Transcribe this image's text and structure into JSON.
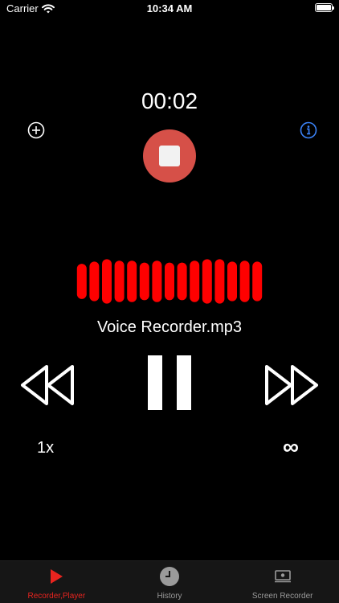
{
  "status_bar": {
    "carrier": "Carrier",
    "time": "10:34 AM",
    "wifi_icon": "wifi-icon",
    "battery_icon": "battery-icon"
  },
  "recorder": {
    "elapsed": "00:02",
    "add_icon": "plus-circle-icon",
    "info_icon": "info-circle-icon",
    "stop_icon": "stop-icon"
  },
  "waveform": {
    "color": "#ff0000",
    "levels": [
      0.73,
      0.82,
      0.92,
      0.86,
      0.86,
      0.78,
      0.86,
      0.78,
      0.78,
      0.86,
      0.92,
      0.92,
      0.82,
      0.86,
      0.82
    ]
  },
  "player": {
    "file_name": "Voice Recorder.mp3",
    "speed": "1x",
    "loop": "∞",
    "rewind_icon": "rewind-icon",
    "pause_icon": "pause-icon",
    "forward_icon": "fast-forward-icon"
  },
  "tabs": [
    {
      "label": "Recorder,Player",
      "icon": "play-icon",
      "active": true
    },
    {
      "label": "History",
      "icon": "clock-icon",
      "active": false
    },
    {
      "label": "Screen Recorder",
      "icon": "screen-recorder-icon",
      "active": false
    }
  ],
  "colors": {
    "background": "#000000",
    "accent_red": "#e8241f",
    "stop_button": "#d65048",
    "info_blue": "#3b82f6",
    "tab_bar": "#161616",
    "tab_inactive": "#9a9a9a"
  }
}
